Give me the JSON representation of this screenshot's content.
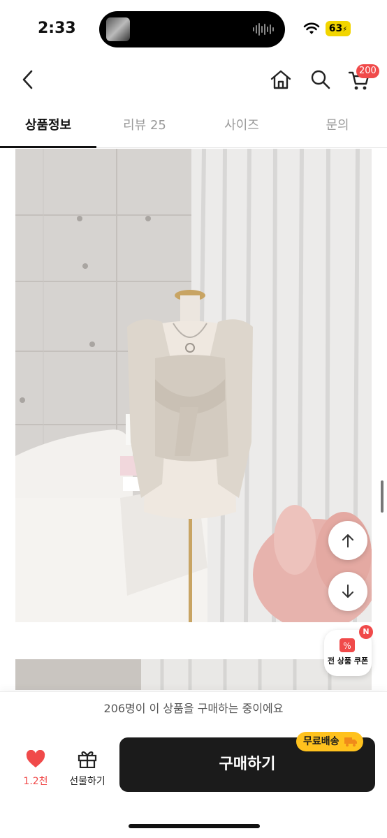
{
  "status_bar": {
    "time": "2:33",
    "battery": "63"
  },
  "header": {
    "cart_count": "200"
  },
  "tabs": [
    {
      "label": "상품정보"
    },
    {
      "label": "리뷰 25"
    },
    {
      "label": "사이즈"
    },
    {
      "label": "문의"
    }
  ],
  "coupon": {
    "label": "전 상품 쿠폰",
    "badge": "N"
  },
  "banner": {
    "text": "206명이 이 상품을 구매하는 중이에요"
  },
  "bottom": {
    "like_count": "1.2천",
    "gift_label": "선물하기",
    "buy_label": "구매하기",
    "shipping_label": "무료배송"
  },
  "colors": {
    "accent": "#f04a4a",
    "buy_button": "#1b1b1b",
    "shipping_badge": "#ffc21e"
  }
}
